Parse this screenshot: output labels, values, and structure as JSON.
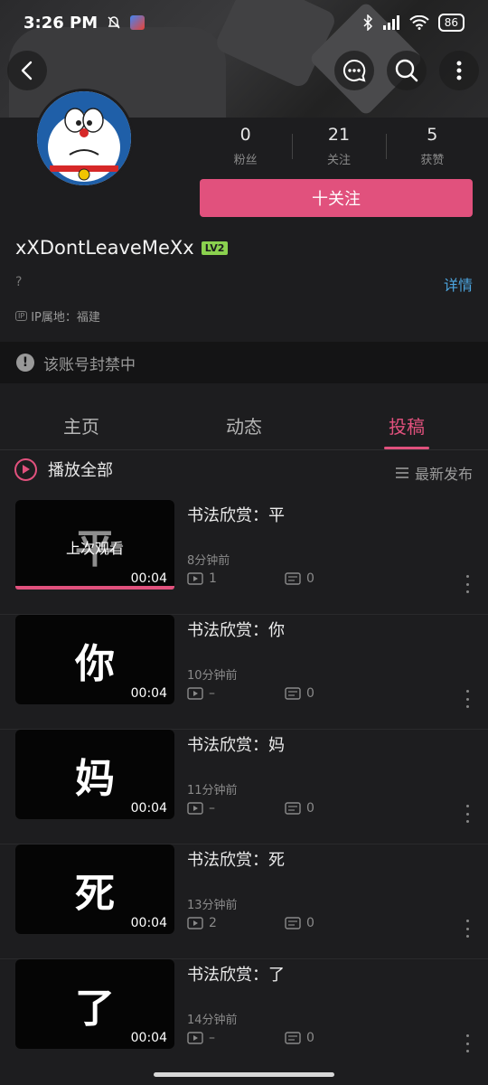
{
  "status_bar": {
    "time": "3:26 PM",
    "battery": "86"
  },
  "profile": {
    "stats": [
      {
        "value": "0",
        "label": "粉丝"
      },
      {
        "value": "21",
        "label": "关注"
      },
      {
        "value": "5",
        "label": "获赞"
      }
    ],
    "follow_label": "十关注",
    "username": "xXDontLeaveMeXx",
    "level": "LV2",
    "signature": "?",
    "detail_label": "详情",
    "ip_badge": "IP",
    "ip_location": "IP属地：福建",
    "banned_notice": "该账号封禁中"
  },
  "tabs": [
    {
      "label": "主页"
    },
    {
      "label": "动态"
    },
    {
      "label": "投稿"
    }
  ],
  "list_header": {
    "play_all": "播放全部",
    "sort": "最新发布"
  },
  "videos": [
    {
      "title": "书法欣赏：平",
      "glyph": "平",
      "duration": "00:04",
      "time": "8分钟前",
      "plays": "1",
      "comments": "0",
      "watched_label": "上次观看",
      "progress": 1.0
    },
    {
      "title": "书法欣赏：你",
      "glyph": "你",
      "duration": "00:04",
      "time": "10分钟前",
      "plays": "–",
      "comments": "0"
    },
    {
      "title": "书法欣赏：妈",
      "glyph": "妈",
      "duration": "00:04",
      "time": "11分钟前",
      "plays": "–",
      "comments": "0"
    },
    {
      "title": "书法欣赏：死",
      "glyph": "死",
      "duration": "00:04",
      "time": "13分钟前",
      "plays": "2",
      "comments": "0"
    },
    {
      "title": "书法欣赏：了",
      "glyph": "了",
      "duration": "00:04",
      "time": "14分钟前",
      "plays": "–",
      "comments": "0"
    }
  ],
  "colors": {
    "accent": "#e1517d",
    "link": "#4da6e0",
    "background": "#1d1d1f"
  }
}
